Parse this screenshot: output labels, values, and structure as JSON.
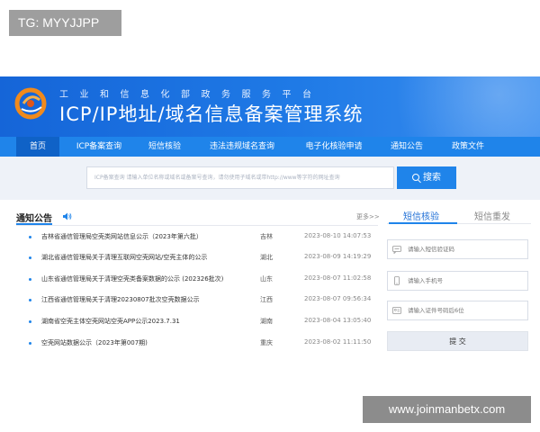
{
  "overlay_tag": "TG: MYYJJPP",
  "header": {
    "subtitle": "工业和信息化部政务服务平台",
    "title": "ICP/IP地址/域名信息备案管理系统"
  },
  "nav": {
    "items": [
      {
        "label": "首页",
        "active": true
      },
      {
        "label": "ICP备案查询",
        "active": false
      },
      {
        "label": "短信核验",
        "active": false
      },
      {
        "label": "违法违规域名查询",
        "active": false
      },
      {
        "label": "电子化核验申请",
        "active": false
      },
      {
        "label": "通知公告",
        "active": false
      },
      {
        "label": "政策文件",
        "active": false
      }
    ]
  },
  "search": {
    "placeholder": "ICP备案查询  请输入单位名称或域名或备案号查询，请勿使用子域名或带http://www等字符的网址查询",
    "button_label": "搜索"
  },
  "notices": {
    "title": "通知公告",
    "more": "更多>>",
    "items": [
      {
        "title": "吉林省通信管理局空壳类网站信息公示（2023年第六批）",
        "province": "吉林",
        "date": "2023-08-10 14:07:53"
      },
      {
        "title": "湖北省通信管理局关于清理互联网空壳网站/空壳主体的公示",
        "province": "湖北",
        "date": "2023-08-09 14:19:29"
      },
      {
        "title": "山东省通信管理局关于清理空壳类备案数据的公示 (202326批次)",
        "province": "山东",
        "date": "2023-08-07 11:02:58"
      },
      {
        "title": "江西省通信管理局关于清理20230807批次空壳数据公示",
        "province": "江西",
        "date": "2023-08-07 09:56:34"
      },
      {
        "title": "湖南省空壳主体空壳网站空壳APP公示2023.7.31",
        "province": "湖南",
        "date": "2023-08-04 13:05:40"
      },
      {
        "title": "空壳网站数据公示（2023年第007期)",
        "province": "重庆",
        "date": "2023-08-02 11:11:50"
      }
    ]
  },
  "sms": {
    "tab_verify": "短信核验",
    "tab_resend": "短信重发",
    "code_placeholder": "请输入短信验证码",
    "phone_placeholder": "请输入手机号",
    "id_placeholder": "请输入证件号码后6位",
    "submit_label": "提 交"
  },
  "watermark": "www.joinmanbetx.com",
  "colors": {
    "brand_blue": "#1f84ea",
    "banner_blue": "#1565d8",
    "logo_orange": "#f08a1c"
  }
}
